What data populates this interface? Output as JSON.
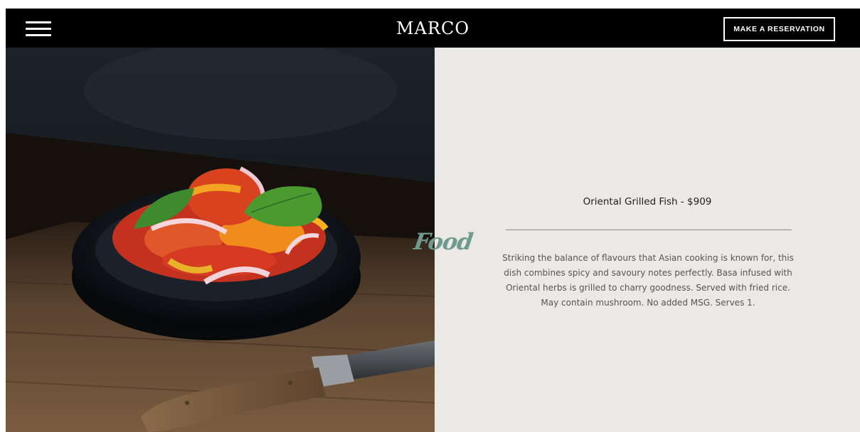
{
  "header": {
    "logo": "MARCO",
    "reservation_button": "MAKE A RESERVATION",
    "menu_icon": "hamburger-menu-icon"
  },
  "section_label": "Food",
  "dish": {
    "title": "Oriental Grilled Fish - $909",
    "description": "Striking the balance of flavours that Asian cooking is known for, this dish combines spicy and savoury notes perfectly. Basa infused with Oriental herbs is grilled to charry goodness. Served with fried rice. May contain mushroom. No added MSG. Serves 1."
  },
  "colors": {
    "header_bg": "#000000",
    "panel_bg": "#ebe9e6",
    "accent_script": "#6f9a8e"
  }
}
